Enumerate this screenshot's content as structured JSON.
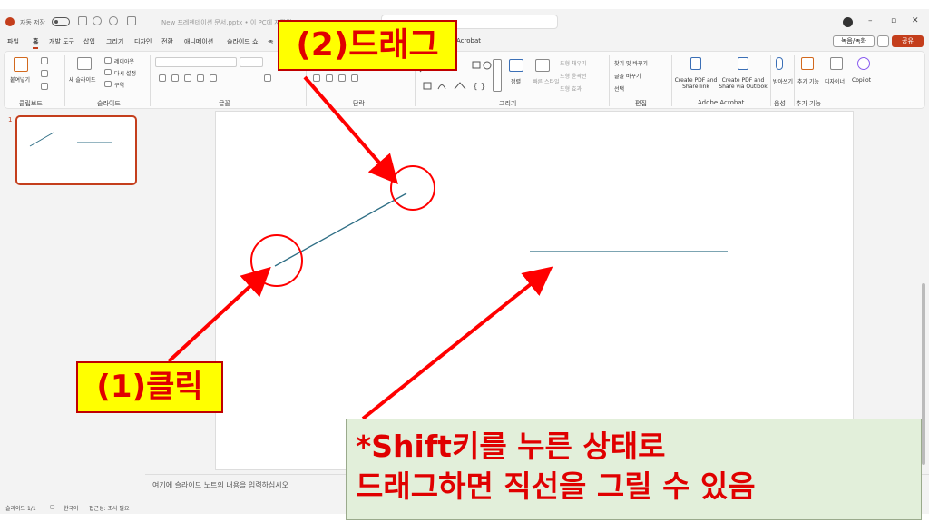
{
  "titlebar": {
    "autosave_label": "자동 저장",
    "file_name": "New 프레젠테이션 문서.pptx • 이 PC에 저장됨"
  },
  "tabs": [
    "파일",
    "홈",
    "개발 도구",
    "삽입",
    "그리기",
    "디자인",
    "전환",
    "애니메이션",
    "슬라이드 쇼",
    "녹",
    "Acrobat"
  ],
  "tabs_active": "홈",
  "header_buttons": {
    "record": "녹음/녹화",
    "share": "공유"
  },
  "ribbon": {
    "clipboard": {
      "paste": "붙여넣기",
      "label": "클립보드"
    },
    "slides": {
      "new_slide": "새 슬라이드",
      "layout": "레이아웃",
      "reset": "다시 설정",
      "section": "구역",
      "label": "슬라이드"
    },
    "font": {
      "label": "글꼴"
    },
    "paragraph": {
      "label": "단락"
    },
    "drawing": {
      "arrange": "정렬",
      "quick_styles": "빠른 스타일",
      "fill": "도형 채우기",
      "outline": "도형 윤곽선",
      "effects": "도형 효과",
      "label": "그리기"
    },
    "editing": {
      "find": "찾기 및 바꾸기",
      "replace": "글꼴 바꾸기",
      "select": "선택",
      "label": "편집"
    },
    "acrobat": {
      "create_pdf": "Create PDF and Share link",
      "create_pdf_outlook": "Create PDF and Share via Outlook",
      "label": "Adobe Acrobat"
    },
    "voice": {
      "dictate": "받아쓰기",
      "label": "음성"
    },
    "addins": {
      "addins": "추가 기능",
      "label": "추가 기능"
    },
    "designer": "디자이너",
    "copilot": "Copilot"
  },
  "pane": {
    "slide_number": "1"
  },
  "notes_placeholder": "여기에 슬라이드 노트의 내용을 입력하십시오",
  "status": {
    "slide_count": "슬라이드 1/1",
    "language": "한국어",
    "accessibility": "접근성: 조사 필요"
  },
  "annotations": {
    "drag": "(2)드래그",
    "click": "(1)클릭",
    "note_line1": "*Shift키를 누른 상태로",
    "note_line2": "드래그하면 직선을 그릴 수 있음"
  },
  "colors": {
    "accent": "#c43e1c",
    "line": "#2e6e85",
    "arrow": "#ff0000",
    "callout_bg": "#ffff00",
    "callout_text": "#e00000",
    "note_bg": "#e2efda"
  }
}
